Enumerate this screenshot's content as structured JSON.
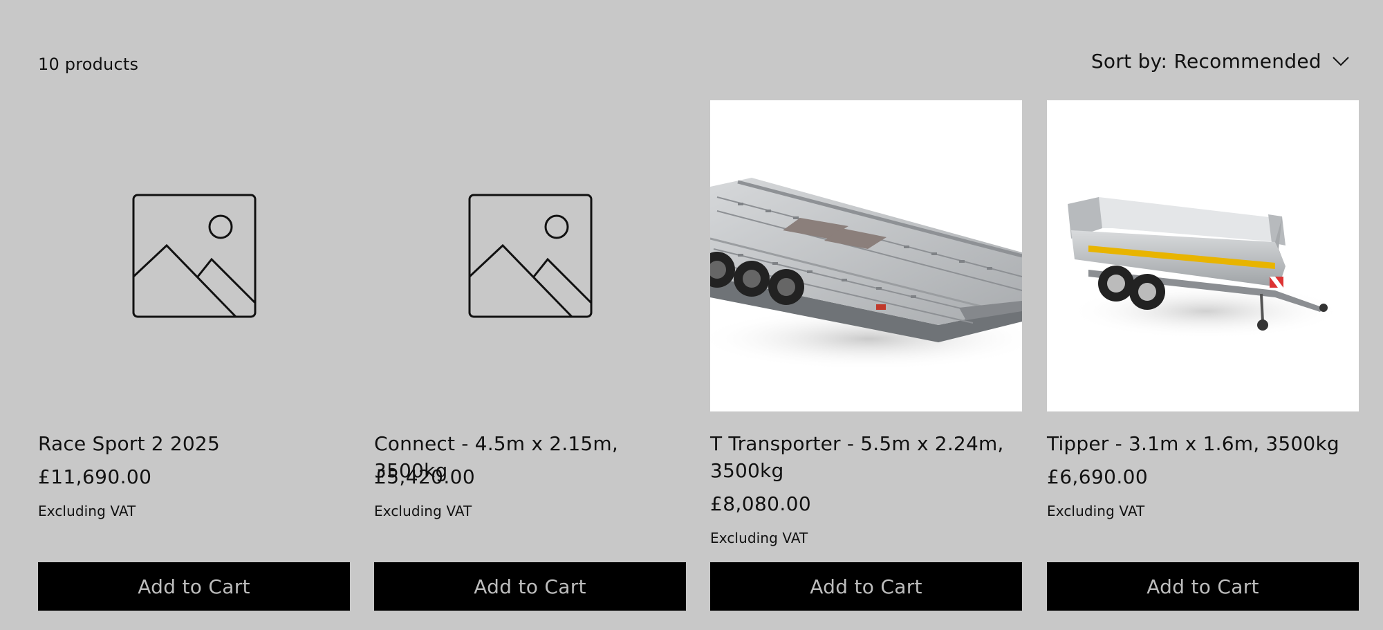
{
  "collection": {
    "product_count": "10 products",
    "sort_label": "Sort by: Recommended"
  },
  "products": [
    {
      "title": "Race Sport 2 2025",
      "price": "£11,690.00",
      "vat_note": "Excluding VAT",
      "cta": "Add to Cart",
      "image": "placeholder-image-icon"
    },
    {
      "title": "Connect - 4.5m x 2.15m, 3500kg",
      "price": "£5,420.00",
      "vat_note": "Excluding VAT",
      "cta": "Add to Cart",
      "image": "placeholder-image-icon"
    },
    {
      "title": "T Transporter - 5.5m x 2.24m, 3500kg",
      "price": "£8,080.00",
      "vat_note": "Excluding VAT",
      "cta": "Add to Cart",
      "image": "car-transporter-trailer-photo"
    },
    {
      "title": "Tipper - 3.1m x 1.6m, 3500kg",
      "price": "£6,690.00",
      "vat_note": "Excluding VAT",
      "cta": "Add to Cart",
      "image": "tipper-trailer-photo"
    }
  ],
  "colors": {
    "page_background": "#c8c8c8",
    "button_background": "#000000",
    "button_text": "#bdbdbd",
    "image_background": "#ffffff"
  }
}
